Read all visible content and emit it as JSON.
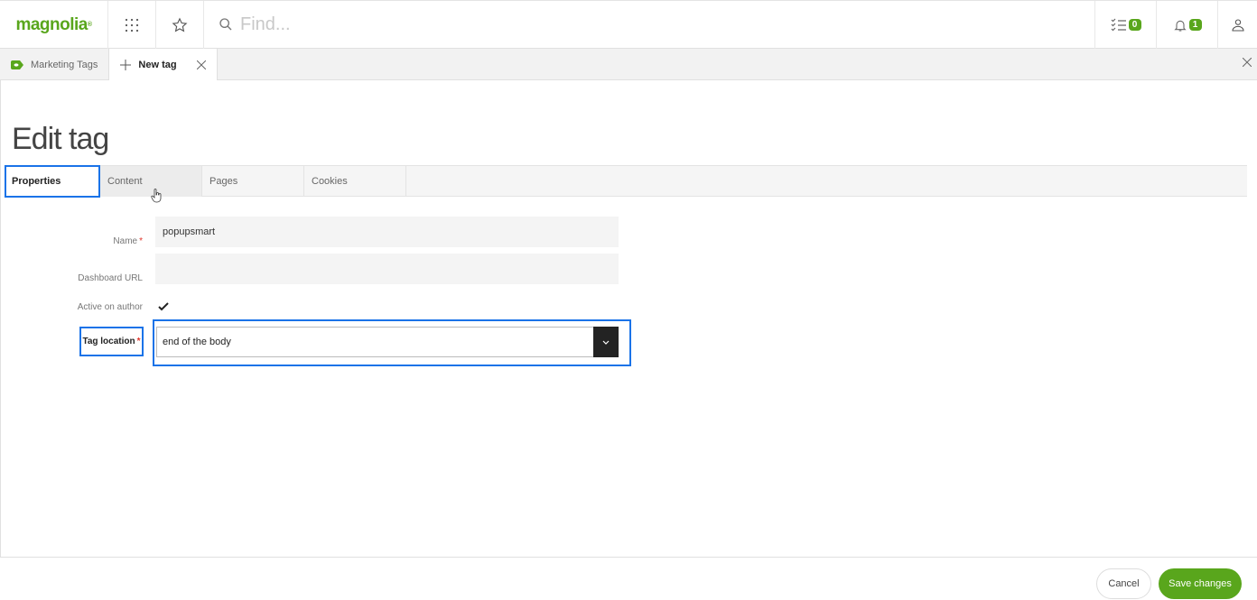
{
  "topbar": {
    "logo": "magnolia",
    "search_placeholder": "Find...",
    "tasks_count": "0",
    "notifications_count": "1"
  },
  "tabbar": {
    "tabs": [
      {
        "label": "Marketing Tags"
      },
      {
        "label": "New tag"
      }
    ]
  },
  "page": {
    "title": "Edit tag"
  },
  "subtabs": [
    {
      "label": "Properties",
      "active": true
    },
    {
      "label": "Content"
    },
    {
      "label": "Pages"
    },
    {
      "label": "Cookies"
    }
  ],
  "form": {
    "name_label": "Name",
    "name_value": "popupsmart",
    "dashboard_label": "Dashboard URL",
    "dashboard_value": "",
    "active_label": "Active on author",
    "active_checked": true,
    "location_label": "Tag location",
    "location_value": "end of the body",
    "required_mark": "*"
  },
  "footer": {
    "cancel_label": "Cancel",
    "save_label": "Save changes"
  },
  "colors": {
    "brand": "#59a61c",
    "highlight": "#1a73e8",
    "required": "#e0362c"
  }
}
